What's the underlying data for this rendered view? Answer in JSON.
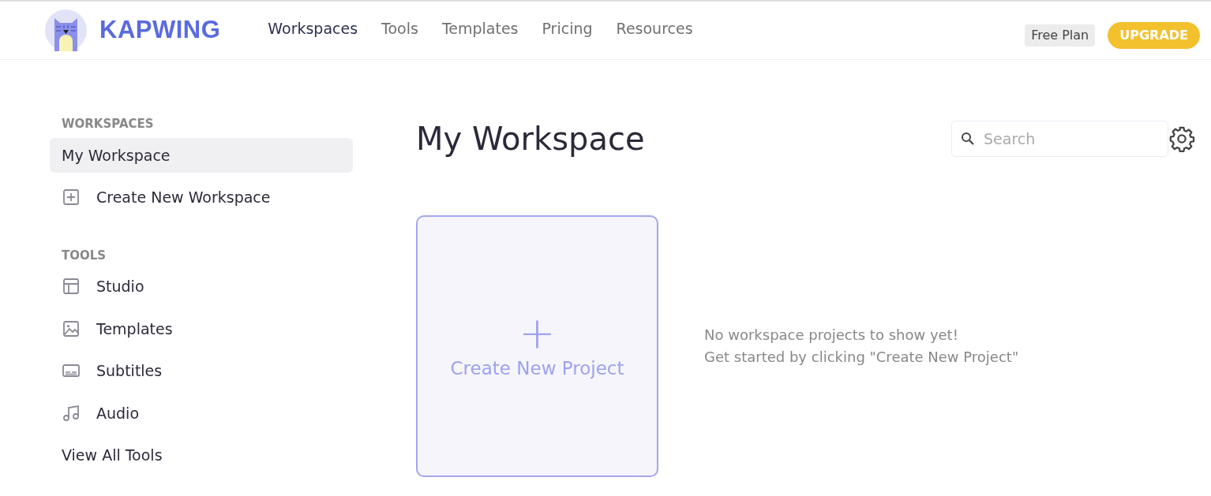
{
  "brand": {
    "name": "KAPWING"
  },
  "nav": [
    {
      "label": "Workspaces",
      "selected": true
    },
    {
      "label": "Tools",
      "selected": false
    },
    {
      "label": "Templates",
      "selected": false
    },
    {
      "label": "Pricing",
      "selected": false
    },
    {
      "label": "Resources",
      "selected": false
    }
  ],
  "plan_badge": "Free Plan",
  "upgrade_button": "UPGRADE",
  "sidebar": {
    "sections": [
      {
        "heading": "WORKSPACES",
        "items": [
          {
            "label": "My Workspace",
            "kind": "workspace",
            "selected": true
          },
          {
            "label": "Create New Workspace",
            "kind": "create",
            "selected": false
          }
        ]
      },
      {
        "heading": "TOOLS",
        "items": [
          {
            "label": "Studio",
            "kind": "tool",
            "selected": false
          },
          {
            "label": "Templates",
            "kind": "tool",
            "selected": false
          },
          {
            "label": "Subtitles",
            "kind": "tool",
            "selected": false
          },
          {
            "label": "Audio",
            "kind": "tool",
            "selected": false
          },
          {
            "label": "View All Tools",
            "kind": "link",
            "selected": false
          }
        ]
      }
    ]
  },
  "main": {
    "title": "My Workspace",
    "search": {
      "placeholder": "Search"
    },
    "create_card": {
      "plus": "+",
      "label": "Create New Project"
    },
    "empty_message": [
      "No workspace projects to show yet!",
      "Get started by clicking \"Create New Project\""
    ]
  }
}
